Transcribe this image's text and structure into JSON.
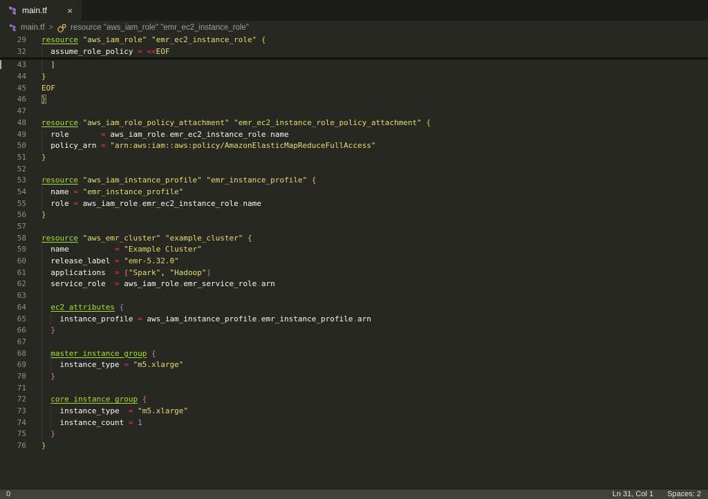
{
  "window_title": "main.tf",
  "icons": {
    "tab_file_icon": "terraform-icon",
    "tab_close_icon": "close-icon",
    "breadcrumb_file_icon": "terraform-icon",
    "breadcrumb_symbol_icon": "symbol-class-icon",
    "breadcrumb_separator_icon": "chevron-right-icon"
  },
  "colors": {
    "editor_background": "#272822",
    "tab_bar_background": "#1b1c17",
    "active_tab_background": "#272822",
    "line_number": "#90908a",
    "foreground": "#f8f8f2",
    "keyword_green": "#a6e22e",
    "string_yellow": "#e6db74",
    "operator_pink": "#f92672",
    "number_purple": "#ae81ff",
    "bracket_level1_gold": "#e5c453",
    "bracket_level2_pink": "#e26fae",
    "terraform_purple": "#9a6fd4",
    "symbol_orange": "#e8ab53",
    "status_bar_background": "#40423a"
  },
  "tab_bar": {
    "tabs": [
      {
        "label": "main.tf",
        "close": "×",
        "active": true
      }
    ]
  },
  "breadcrumb": {
    "file": "main.tf",
    "separator": ">",
    "symbol": "resource \"aws_iam_role\" \"emr_ec2_instance_role\""
  },
  "editor": {
    "sticky_lines": [
      {
        "n": "29",
        "g": 0,
        "tokens": [
          [
            "kw",
            "resource"
          ],
          [
            "fg",
            " "
          ],
          [
            "str",
            "\"aws_iam_role\""
          ],
          [
            "fg",
            " "
          ],
          [
            "str",
            "\"emr_ec2_instance_role\""
          ],
          [
            "fg",
            " "
          ],
          [
            "b1",
            "{"
          ]
        ]
      },
      {
        "n": "32",
        "g": 1,
        "tokens": [
          [
            "fg",
            "  assume_role_policy "
          ],
          [
            "op",
            "="
          ],
          [
            "fg",
            " "
          ],
          [
            "op",
            "<<"
          ],
          [
            "str",
            "EOF"
          ]
        ]
      }
    ],
    "lines": [
      {
        "n": "43",
        "g": 1,
        "tokens": [
          [
            "str",
            "  ]"
          ]
        ]
      },
      {
        "n": "44",
        "g": 0,
        "tokens": [
          [
            "str",
            "}"
          ]
        ]
      },
      {
        "n": "45",
        "g": 0,
        "tokens": [
          [
            "str",
            "EOF"
          ]
        ]
      },
      {
        "n": "46",
        "g": 0,
        "tokens": [
          [
            "b1m",
            "}"
          ]
        ]
      },
      {
        "n": "47",
        "g": 0,
        "tokens": []
      },
      {
        "n": "48",
        "g": 0,
        "tokens": [
          [
            "kw",
            "resource"
          ],
          [
            "fg",
            " "
          ],
          [
            "str",
            "\"aws_iam_role_policy_attachment\""
          ],
          [
            "fg",
            " "
          ],
          [
            "str",
            "\"emr_ec2_instance_role_policy_attachment\""
          ],
          [
            "fg",
            " "
          ],
          [
            "b1",
            "{"
          ]
        ]
      },
      {
        "n": "49",
        "g": 1,
        "tokens": [
          [
            "fg",
            "  role       "
          ],
          [
            "op",
            "="
          ],
          [
            "fg",
            " aws_iam_role"
          ],
          [
            "op",
            "."
          ],
          [
            "fg",
            "emr_ec2_instance_role"
          ],
          [
            "op",
            "."
          ],
          [
            "fg",
            "name"
          ]
        ]
      },
      {
        "n": "50",
        "g": 1,
        "tokens": [
          [
            "fg",
            "  policy_arn "
          ],
          [
            "op",
            "="
          ],
          [
            "fg",
            " "
          ],
          [
            "str",
            "\"arn:aws:iam::aws:policy/AmazonElasticMapReduceFullAccess\""
          ]
        ]
      },
      {
        "n": "51",
        "g": 0,
        "tokens": [
          [
            "b1",
            "}"
          ]
        ]
      },
      {
        "n": "52",
        "g": 0,
        "tokens": []
      },
      {
        "n": "53",
        "g": 0,
        "tokens": [
          [
            "kw",
            "resource"
          ],
          [
            "fg",
            " "
          ],
          [
            "str",
            "\"aws_iam_instance_profile\""
          ],
          [
            "fg",
            " "
          ],
          [
            "str",
            "\"emr_instance_profile\""
          ],
          [
            "fg",
            " "
          ],
          [
            "b1",
            "{"
          ]
        ]
      },
      {
        "n": "54",
        "g": 1,
        "tokens": [
          [
            "fg",
            "  name "
          ],
          [
            "op",
            "="
          ],
          [
            "fg",
            " "
          ],
          [
            "str",
            "\"emr_instance_profile\""
          ]
        ]
      },
      {
        "n": "55",
        "g": 1,
        "tokens": [
          [
            "fg",
            "  role "
          ],
          [
            "op",
            "="
          ],
          [
            "fg",
            " aws_iam_role"
          ],
          [
            "op",
            "."
          ],
          [
            "fg",
            "emr_ec2_instance_role"
          ],
          [
            "op",
            "."
          ],
          [
            "fg",
            "name"
          ]
        ]
      },
      {
        "n": "56",
        "g": 0,
        "tokens": [
          [
            "b1",
            "}"
          ]
        ]
      },
      {
        "n": "57",
        "g": 0,
        "tokens": []
      },
      {
        "n": "58",
        "g": 0,
        "tokens": [
          [
            "kw",
            "resource"
          ],
          [
            "fg",
            " "
          ],
          [
            "str",
            "\"aws_emr_cluster\""
          ],
          [
            "fg",
            " "
          ],
          [
            "str",
            "\"example_cluster\""
          ],
          [
            "fg",
            " "
          ],
          [
            "b1",
            "{"
          ]
        ]
      },
      {
        "n": "59",
        "g": 1,
        "tokens": [
          [
            "fg",
            "  name          "
          ],
          [
            "op",
            "="
          ],
          [
            "fg",
            " "
          ],
          [
            "str",
            "\"Example Cluster\""
          ]
        ]
      },
      {
        "n": "60",
        "g": 1,
        "tokens": [
          [
            "fg",
            "  release_label "
          ],
          [
            "op",
            "="
          ],
          [
            "fg",
            " "
          ],
          [
            "str",
            "\"emr-5.32.0\""
          ]
        ]
      },
      {
        "n": "61",
        "g": 1,
        "tokens": [
          [
            "fg",
            "  applications  "
          ],
          [
            "op",
            "="
          ],
          [
            "fg",
            " "
          ],
          [
            "b2",
            "["
          ],
          [
            "str",
            "\"Spark\""
          ],
          [
            "fg",
            ", "
          ],
          [
            "str",
            "\"Hadoop\""
          ],
          [
            "b2",
            "]"
          ]
        ]
      },
      {
        "n": "62",
        "g": 1,
        "tokens": [
          [
            "fg",
            "  service_role  "
          ],
          [
            "op",
            "="
          ],
          [
            "fg",
            " aws_iam_role"
          ],
          [
            "op",
            "."
          ],
          [
            "fg",
            "emr_service_role"
          ],
          [
            "op",
            "."
          ],
          [
            "fg",
            "arn"
          ]
        ]
      },
      {
        "n": "63",
        "g": 1,
        "tokens": []
      },
      {
        "n": "64",
        "g": 1,
        "tokens": [
          [
            "fg",
            "  "
          ],
          [
            "kw",
            "ec2_attributes"
          ],
          [
            "fg",
            " "
          ],
          [
            "b2",
            "{"
          ]
        ]
      },
      {
        "n": "65",
        "g": 2,
        "tokens": [
          [
            "fg",
            "    instance_profile "
          ],
          [
            "op",
            "="
          ],
          [
            "fg",
            " aws_iam_instance_profile"
          ],
          [
            "op",
            "."
          ],
          [
            "fg",
            "emr_instance_profile"
          ],
          [
            "op",
            "."
          ],
          [
            "fg",
            "arn"
          ]
        ]
      },
      {
        "n": "66",
        "g": 1,
        "tokens": [
          [
            "fg",
            "  "
          ],
          [
            "b2",
            "}"
          ]
        ]
      },
      {
        "n": "67",
        "g": 1,
        "tokens": []
      },
      {
        "n": "68",
        "g": 1,
        "tokens": [
          [
            "fg",
            "  "
          ],
          [
            "kw",
            "master_instance_group"
          ],
          [
            "fg",
            " "
          ],
          [
            "b2",
            "{"
          ]
        ]
      },
      {
        "n": "69",
        "g": 2,
        "tokens": [
          [
            "fg",
            "    instance_type "
          ],
          [
            "op",
            "="
          ],
          [
            "fg",
            " "
          ],
          [
            "str",
            "\"m5.xlarge\""
          ]
        ]
      },
      {
        "n": "70",
        "g": 1,
        "tokens": [
          [
            "fg",
            "  "
          ],
          [
            "b2",
            "}"
          ]
        ]
      },
      {
        "n": "71",
        "g": 1,
        "tokens": []
      },
      {
        "n": "72",
        "g": 1,
        "tokens": [
          [
            "fg",
            "  "
          ],
          [
            "kw",
            "core_instance_group"
          ],
          [
            "fg",
            " "
          ],
          [
            "b2",
            "{"
          ]
        ]
      },
      {
        "n": "73",
        "g": 2,
        "tokens": [
          [
            "fg",
            "    instance_type  "
          ],
          [
            "op",
            "="
          ],
          [
            "fg",
            " "
          ],
          [
            "str",
            "\"m5.xlarge\""
          ]
        ]
      },
      {
        "n": "74",
        "g": 2,
        "tokens": [
          [
            "fg",
            "    instance_count "
          ],
          [
            "op",
            "="
          ],
          [
            "fg",
            " "
          ],
          [
            "num",
            "1"
          ]
        ]
      },
      {
        "n": "75",
        "g": 1,
        "tokens": [
          [
            "fg",
            "  "
          ],
          [
            "b2",
            "}"
          ]
        ]
      },
      {
        "n": "76",
        "g": 0,
        "tokens": [
          [
            "b1",
            "}"
          ]
        ]
      }
    ]
  },
  "status_bar": {
    "left": "0",
    "cursor": "Ln 31, Col 1",
    "spaces": "Spaces: 2"
  }
}
